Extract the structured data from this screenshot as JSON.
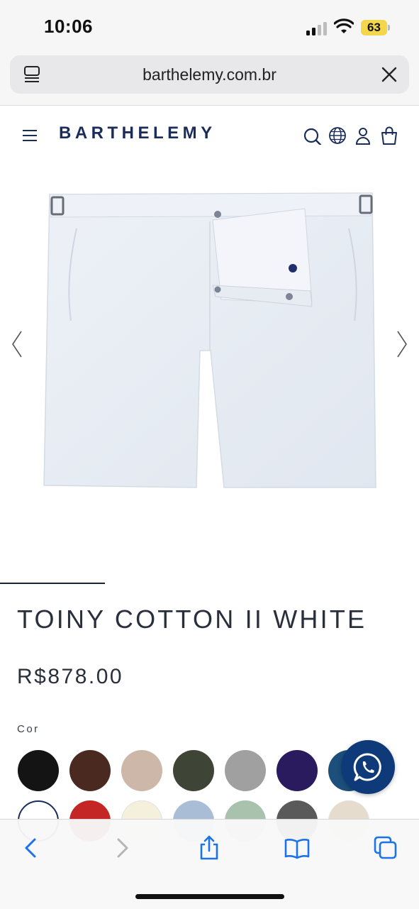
{
  "status_bar": {
    "time": "10:06",
    "battery": "63"
  },
  "address_bar": {
    "url": "barthelemy.com.br"
  },
  "site": {
    "logo": "BARTHELEMY"
  },
  "product": {
    "title": "TOINY COTTON II WHITE",
    "price": "R$878.00",
    "color_label": "Cor"
  },
  "swatches_row1": [
    "#141414",
    "#4a2a20",
    "#ccb7a9",
    "#3f4536",
    "#a0a0a0",
    "#2a1a5e",
    "#1c4f7c"
  ],
  "swatches_row2": [
    "#ffffff",
    "#c42525",
    "#f5f0dc",
    "#a9bdd6",
    "#a8c2ae",
    "#5a5a5a",
    "#e6dccd"
  ],
  "icons": {
    "reader": "reader-icon",
    "close": "close-icon",
    "menu": "hamburger-menu-icon",
    "search": "search-icon",
    "globe": "globe-icon",
    "account": "user-icon",
    "cart": "shopping-bag-icon",
    "prev": "chevron-left-icon",
    "next": "chevron-right-icon",
    "whatsapp": "whatsapp-icon",
    "back": "back-icon",
    "forward": "forward-icon",
    "share": "share-icon",
    "bookmarks": "bookmarks-icon",
    "tabs": "tabs-icon"
  },
  "colors": {
    "brand": "#1a2d5a",
    "whatsapp_bg": "#0f3a7a",
    "battery": "#f4d64b",
    "toolbar_accent": "#1a73e8"
  }
}
